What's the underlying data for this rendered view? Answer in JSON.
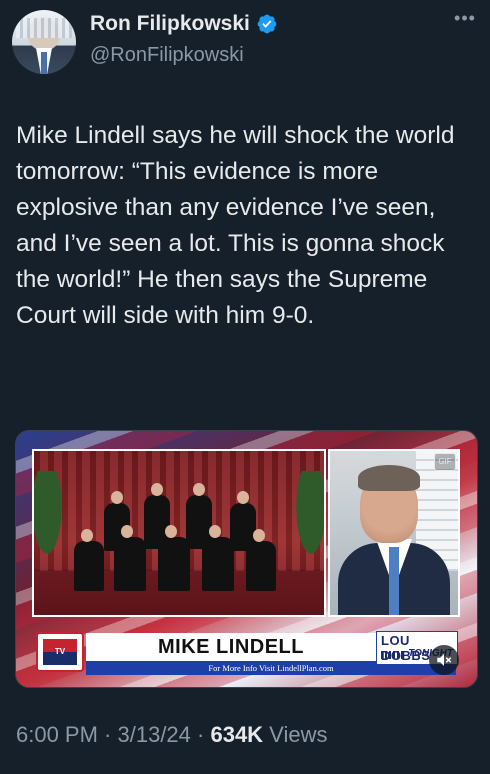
{
  "author": {
    "display_name": "Ron Filipkowski",
    "handle": "@RonFilipkowski",
    "verified": true,
    "verified_color": "#1d9bf0"
  },
  "more_label": "•••",
  "tweet": {
    "text": "Mike Lindell says he will shock the world tomorrow: “This evidence is more explosive than any evidence I’ve seen, and I’ve seen a lot. This is gonna shock the world!” He then says the Supreme Court will side with him 9-0."
  },
  "media": {
    "lower_third_name": "MIKE LINDELL",
    "info_bar": "For More Info Visit LindellPlan.com",
    "show_title": "LOU DOBBS",
    "show_subtitle": "TONIGHT",
    "network_logo_text": "TV",
    "gif_label": "GIF"
  },
  "footer": {
    "time": "6:00 PM",
    "separator": " · ",
    "date": "3/13/24",
    "views_count": "634K",
    "views_label": " Views"
  },
  "colors": {
    "background": "#15202b",
    "text_primary": "#e7e9ea",
    "text_secondary": "#8b98a5",
    "accent": "#1d9bf0"
  }
}
